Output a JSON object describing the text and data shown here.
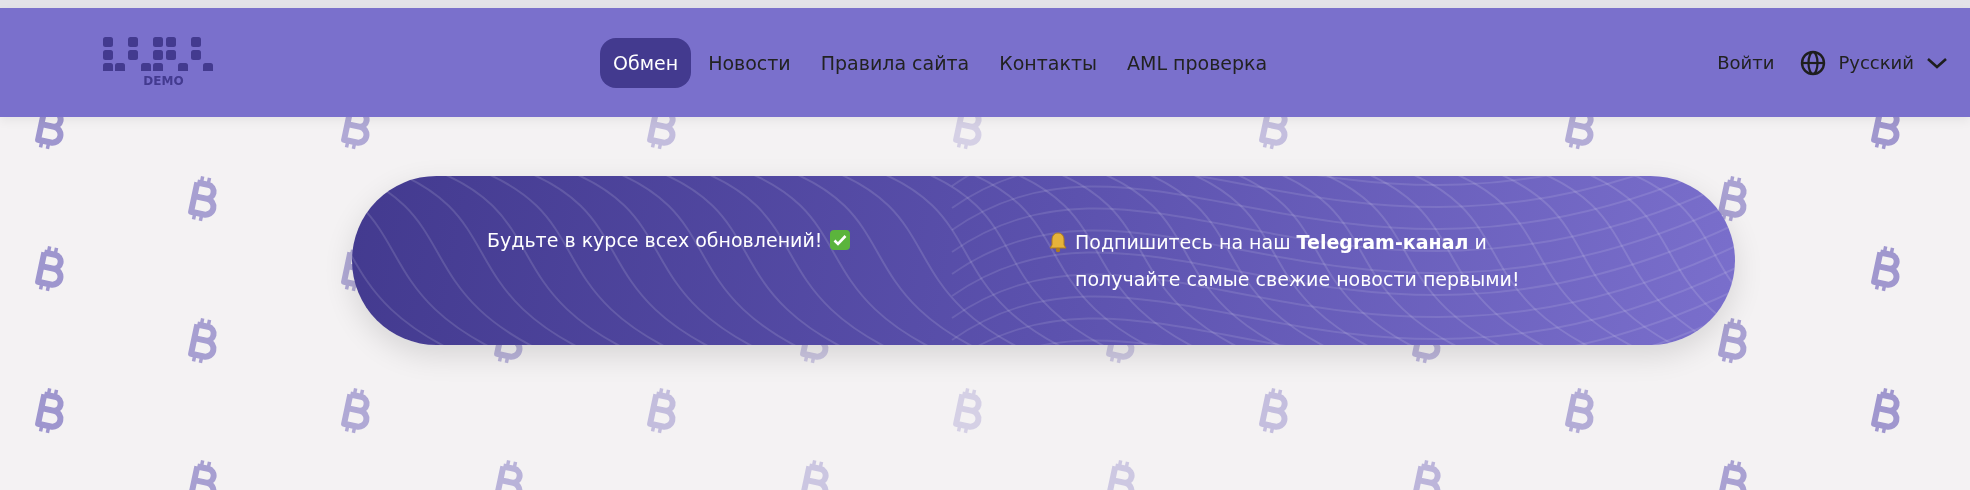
{
  "logo": {
    "caption": "DEMO"
  },
  "nav": [
    {
      "label": "Обмен",
      "selected": true
    },
    {
      "label": "Новости",
      "selected": false
    },
    {
      "label": "Правила сайта",
      "selected": false
    },
    {
      "label": "Контакты",
      "selected": false
    },
    {
      "label": "AML проверка",
      "selected": false
    }
  ],
  "login": "Войти",
  "language": {
    "label": "Русский"
  },
  "banner": {
    "headline": "Будьте в курсе всех обновлений!",
    "message": "Подпишитесь на наш **Telegram-канал** и получайте самые свежие новости первыми!"
  }
}
